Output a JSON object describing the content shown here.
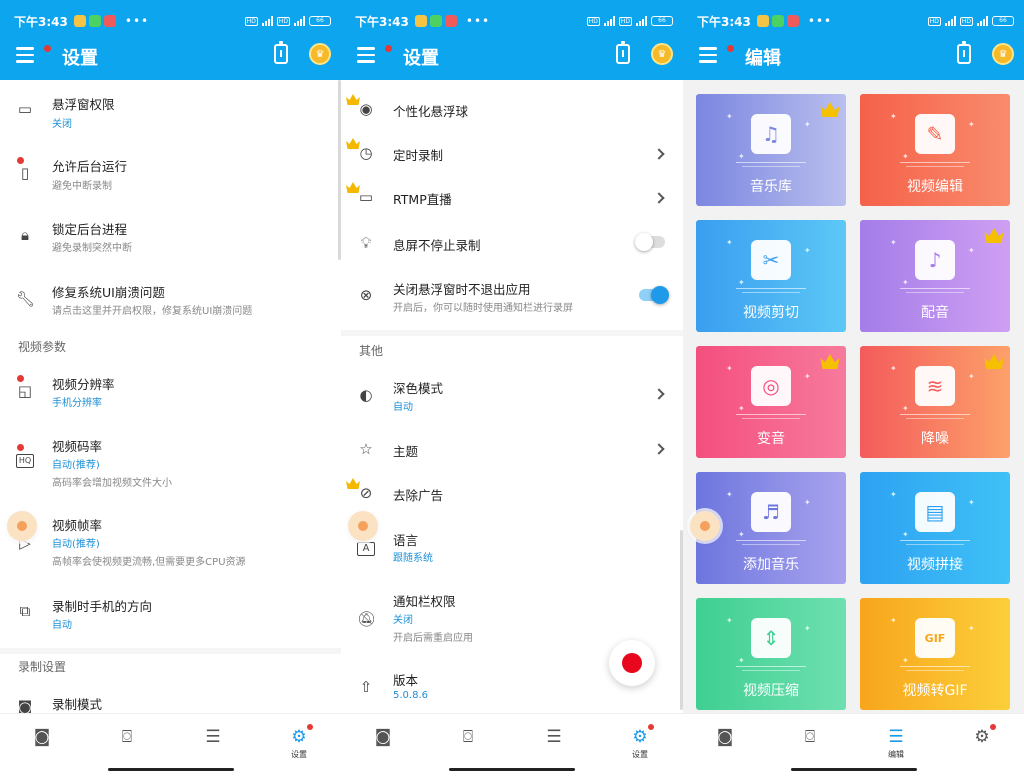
{
  "status": {
    "time": "下午3:43",
    "battery": "66"
  },
  "screen1": {
    "title": "设置",
    "items": [
      {
        "title": "悬浮窗权限",
        "sub1": "关闭",
        "sub2": ""
      },
      {
        "title": "允许后台运行",
        "sub1": "",
        "sub2": "避免中断录制"
      },
      {
        "title": "锁定后台进程",
        "sub1": "",
        "sub2": "避免录制突然中断"
      },
      {
        "title": "修复系统UI崩溃问题",
        "sub1": "",
        "sub2": "请点击这里并开启权限，修复系统UI崩溃问题"
      },
      {
        "title": "视频分辨率",
        "sub1": "手机分辨率",
        "sub2": ""
      },
      {
        "title": "视频码率",
        "sub1": "自动(推荐)",
        "sub2": "高码率会增加视频文件大小"
      },
      {
        "title": "视频帧率",
        "sub1": "自动(推荐)",
        "sub2": "高帧率会使视频更流畅,但需要更多CPU资源"
      },
      {
        "title": "录制时手机的方向",
        "sub1": "自动",
        "sub2": ""
      },
      {
        "title": "录制模式",
        "sub1": "",
        "sub2": ""
      }
    ],
    "sections": [
      "视频参数",
      "录制设置"
    ],
    "hq_label": "HQ"
  },
  "screen2": {
    "title": "设置",
    "items": [
      {
        "title": "个性化悬浮球",
        "sub1": "",
        "sub2": ""
      },
      {
        "title": "定时录制",
        "sub1": "",
        "sub2": ""
      },
      {
        "title": "RTMP直播",
        "sub1": "",
        "sub2": ""
      },
      {
        "title": "息屏不停止录制",
        "sub1": "",
        "sub2": ""
      },
      {
        "title": "关闭悬浮窗时不退出应用",
        "sub1": "",
        "sub2": "开启后，你可以随时使用通知栏进行录屏"
      },
      {
        "title": "深色模式",
        "sub1": "自动",
        "sub2": ""
      },
      {
        "title": "主题",
        "sub1": "",
        "sub2": ""
      },
      {
        "title": "去除广告",
        "sub1": "",
        "sub2": ""
      },
      {
        "title": "语言",
        "sub1": "跟随系统",
        "sub2": ""
      },
      {
        "title": "通知栏权限",
        "sub1": "关闭",
        "sub2": "开启后需重启应用"
      },
      {
        "title": "版本",
        "sub1": "5.0.8.6",
        "sub2": ""
      }
    ],
    "sections": [
      "其他"
    ],
    "switch_states": {
      "screen_off": false,
      "keep_app": true
    }
  },
  "screen3": {
    "title": "编辑",
    "tiles": [
      {
        "label": "音乐库",
        "from": "#7b86e0",
        "to": "#b9bfee",
        "icon": "music-library-icon",
        "crown": true
      },
      {
        "label": "视频编辑",
        "from": "#f5614a",
        "to": "#f98b6c",
        "icon": "video-edit-icon",
        "crown": false
      },
      {
        "label": "视频剪切",
        "from": "#3a9ef0",
        "to": "#5cc8f6",
        "icon": "video-cut-icon",
        "crown": false
      },
      {
        "label": "配音",
        "from": "#a47de8",
        "to": "#cf9ff3",
        "icon": "dubbing-icon",
        "crown": true
      },
      {
        "label": "变音",
        "from": "#f44f7e",
        "to": "#f77a9c",
        "icon": "voice-change-icon",
        "crown": true
      },
      {
        "label": "降噪",
        "from": "#f45b5b",
        "to": "#fca16a",
        "icon": "denoise-icon",
        "crown": true
      },
      {
        "label": "添加音乐",
        "from": "#6d76de",
        "to": "#a9a3ee",
        "icon": "add-music-icon",
        "crown": false
      },
      {
        "label": "视频拼接",
        "from": "#2ea2f2",
        "to": "#3fc1f6",
        "icon": "video-join-icon",
        "crown": false
      },
      {
        "label": "视频压缩",
        "from": "#3fcf92",
        "to": "#6ee0b0",
        "icon": "video-compress-icon",
        "crown": false
      },
      {
        "label": "视频转GIF",
        "from": "#f8a51c",
        "to": "#fccf3a",
        "icon": "video-to-gif-icon",
        "crown": false
      }
    ],
    "gif_label": "GIF"
  },
  "nav": {
    "settings_label": "设置",
    "edit_label": "编辑"
  },
  "colors": {
    "accent": "#0ea5ef",
    "link": "#1e90d6",
    "record": "#e8071c"
  }
}
